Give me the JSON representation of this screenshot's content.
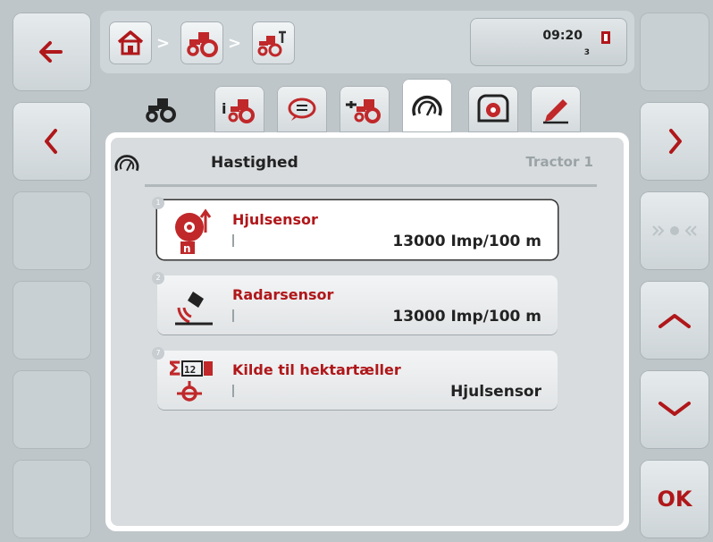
{
  "topbar": {
    "time": "09:20",
    "count": "3"
  },
  "panel": {
    "title": "Hastighed",
    "context": "Tractor 1"
  },
  "items": [
    {
      "number": "1",
      "label": "Hjulsensor",
      "value": "13000 Imp/100 m"
    },
    {
      "number": "2",
      "label": "Radarsensor",
      "value": "13000 Imp/100 m"
    },
    {
      "number": "7",
      "label": "Kilde til hektartæller",
      "value": "Hjulsensor"
    }
  ],
  "right": {
    "ok_label": "OK"
  },
  "colors": {
    "accent": "#b0171a",
    "icon_red": "#c0282a"
  }
}
